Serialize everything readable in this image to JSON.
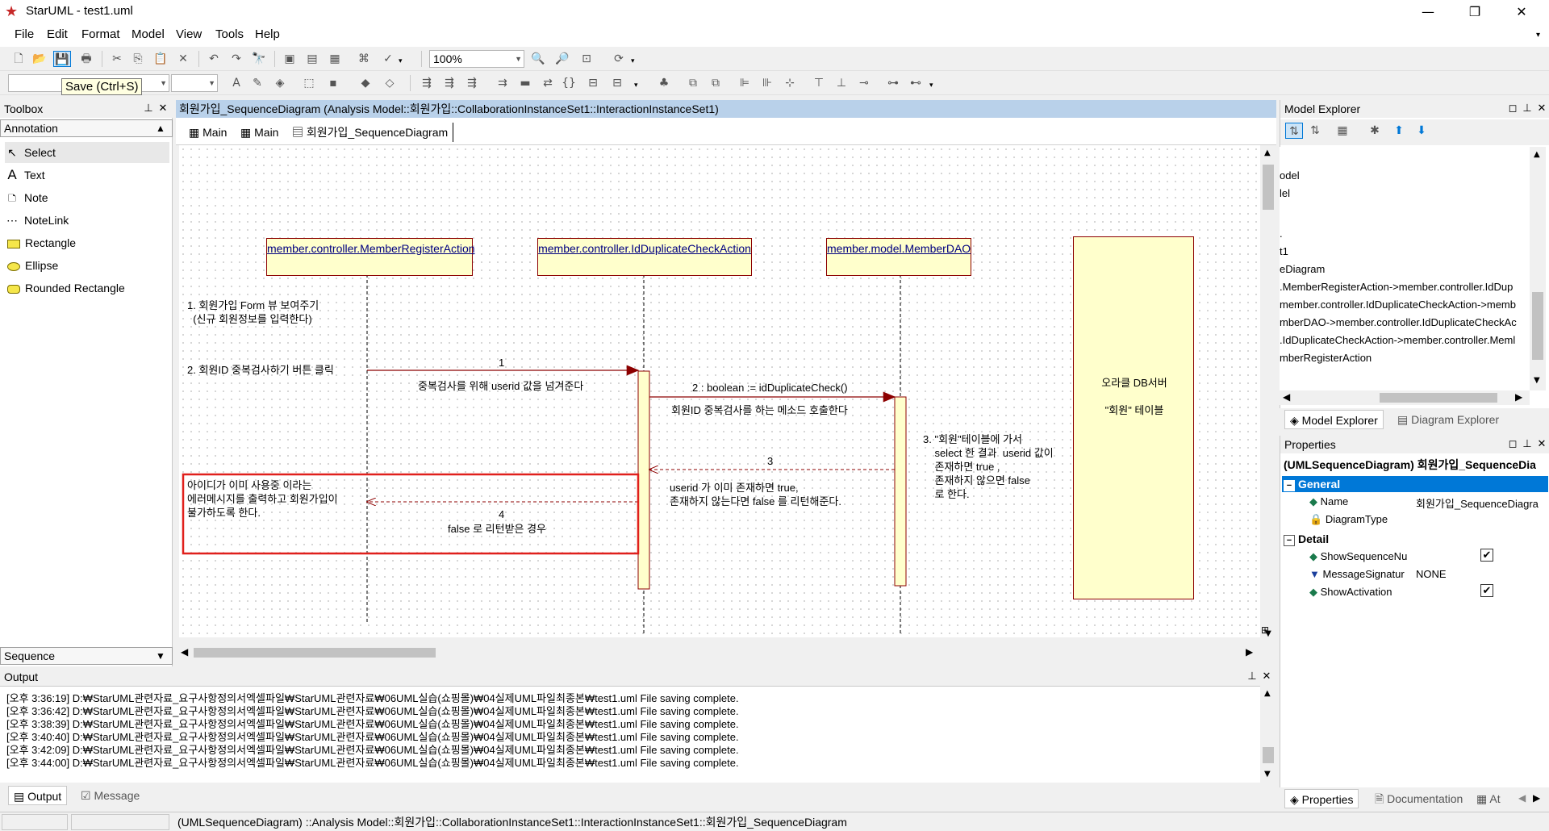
{
  "window": {
    "title": "StarUML - test1.uml",
    "minimize": "—",
    "maximize": "❐",
    "close": "✕"
  },
  "menu": [
    "File",
    "Edit",
    "Format",
    "Model",
    "View",
    "Tools",
    "Help"
  ],
  "toolbar": {
    "zoom": "100%",
    "tooltip": "Save (Ctrl+S)"
  },
  "toolbox": {
    "title": "Toolbox",
    "section": "Annotation",
    "items": [
      "Select",
      "Text",
      "Note",
      "NoteLink",
      "Rectangle",
      "Ellipse",
      "Rounded Rectangle"
    ],
    "bottom_section": "Sequence"
  },
  "diagram": {
    "header": "회원가입_SequenceDiagram (Analysis Model::회원가입::CollaborationInstanceSet1::InteractionInstanceSet1)",
    "tabs": [
      "Main",
      "Main",
      "회원가입_SequenceDiagram"
    ],
    "lifelines": [
      "member.controller.MemberRegisterAction",
      "member.controller.IdDuplicateCheckAction",
      "member.model.MemberDAO"
    ],
    "db_box": "오라클 DB서버\n\n\"회원\" 테이블",
    "notes": {
      "n1": "1. 회원가입 Form 뷰 보여주기\n  (신규 회원정보를 입력한다)",
      "n2": "2. 회원ID 중복검사하기 버튼 클릭",
      "n3": "3. \"회원\"테이블에 가서\n    select 한 결과  userid 값이\n    존재하면 true ,\n    존재하지 않으면 false\n    로 한다.",
      "n4": "아이디가 이미 사용중 이라는\n에러메시지를 출력하고 회원가입이\n불가하도록 한다."
    },
    "messages": {
      "m1_num": "1",
      "m1_desc": "중복검사를 위해 userid 값을 넘겨준다",
      "m2": "2 : boolean := idDuplicateCheck()",
      "m2_desc": "회원ID 중복검사를 하는 메소드 호출한다",
      "m3_num": "3",
      "m3_desc": "userid 가 이미 존재하면 true,\n존재하지 않는다면 false 를 리턴해준다.",
      "m4_num": "4",
      "m4_desc": "false 로 리턴받은 경우"
    }
  },
  "model_explorer": {
    "title": "Model Explorer",
    "items": [
      "odel",
      "lel",
      "",
      ".",
      "t1",
      "eDiagram",
      ".MemberRegisterAction->member.controller.IdDup",
      "member.controller.IdDuplicateCheckAction->memb",
      "mberDAO->member.controller.IdDuplicateCheckAc",
      ".IdDuplicateCheckAction->member.controller.Meml",
      "mberRegisterAction"
    ],
    "tabs": [
      "Model Explorer",
      "Diagram Explorer"
    ]
  },
  "properties": {
    "title": "Properties",
    "heading": "(UMLSequenceDiagram) 회원가입_SequenceDia",
    "sections": [
      "General",
      "Detail"
    ],
    "general": [
      {
        "name": "Name",
        "value": "회원가입_SequenceDiagra"
      },
      {
        "name": "DiagramType",
        "value": ""
      }
    ],
    "detail": [
      {
        "name": "ShowSequenceNu",
        "value": "✔"
      },
      {
        "name": "MessageSignatur",
        "value": "NONE"
      },
      {
        "name": "ShowActivation",
        "value": "✔"
      }
    ],
    "tabs": [
      "Properties",
      "Documentation",
      "At"
    ]
  },
  "output": {
    "title": "Output",
    "lines": [
      "[오후 3:36:19]  D:₩StarUML관련자료_요구사항정의서엑셀파일₩StarUML관련자료₩06UML실습(쇼핑몰)₩04실제UML파일최종본₩test1.uml File saving complete.",
      "[오후 3:36:42]  D:₩StarUML관련자료_요구사항정의서엑셀파일₩StarUML관련자료₩06UML실습(쇼핑몰)₩04실제UML파일최종본₩test1.uml File saving complete.",
      "[오후 3:38:39]  D:₩StarUML관련자료_요구사항정의서엑셀파일₩StarUML관련자료₩06UML실습(쇼핑몰)₩04실제UML파일최종본₩test1.uml File saving complete.",
      "[오후 3:40:40]  D:₩StarUML관련자료_요구사항정의서엑셀파일₩StarUML관련자료₩06UML실습(쇼핑몰)₩04실제UML파일최종본₩test1.uml File saving complete.",
      "[오후 3:42:09]  D:₩StarUML관련자료_요구사항정의서엑셀파일₩StarUML관련자료₩06UML실습(쇼핑몰)₩04실제UML파일최종본₩test1.uml File saving complete.",
      "[오후 3:44:00]  D:₩StarUML관련자료_요구사항정의서엑셀파일₩StarUML관련자료₩06UML실습(쇼핑몰)₩04실제UML파일최종본₩test1.uml File saving complete."
    ],
    "tabs": [
      "Output",
      "Message"
    ]
  },
  "statusbar": {
    "text": "(UMLSequenceDiagram) ::Analysis Model::회원가입::CollaborationInstanceSet1::InteractionInstanceSet1::회원가입_SequenceDiagram"
  },
  "colors": {
    "lifeline_fill": "#ffffcc",
    "lifeline_border": "#8c0000",
    "message_color": "#8c0000",
    "highlight_red": "#e0201c",
    "selection_blue": "#0078d7"
  }
}
